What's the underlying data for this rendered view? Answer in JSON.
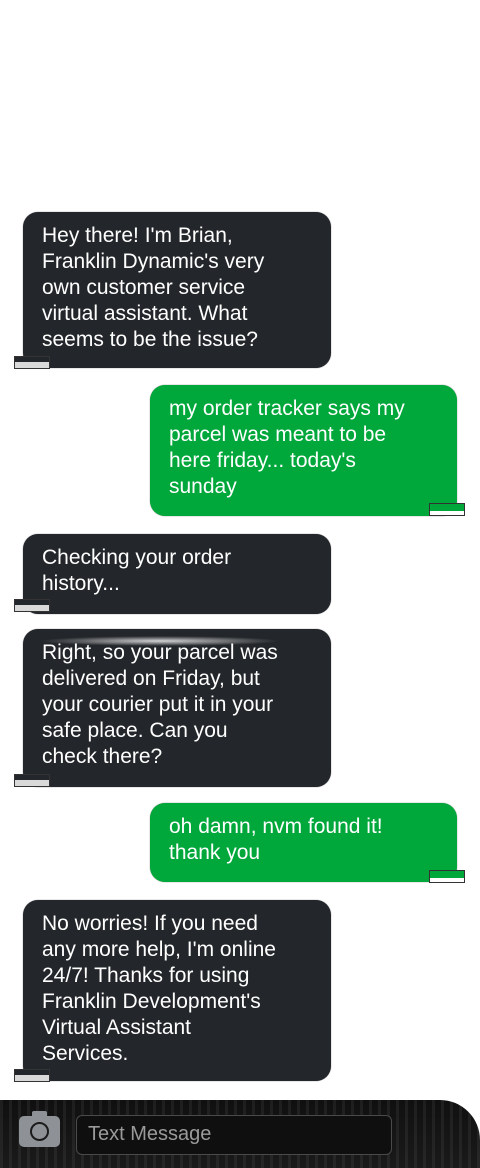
{
  "colors": {
    "incoming_bubble": "#23262a",
    "outgoing_bubble": "#00a73a",
    "text": "#ffffff"
  },
  "messages": [
    {
      "sender": "assistant",
      "text": "Hey there! I'm Brian,\nFranklin Dynamic's very\nown customer service\nvirtual assistant. What\nseems to be the issue?"
    },
    {
      "sender": "user",
      "text": "my order tracker says my\nparcel was meant to be\nhere friday... today's\nsunday"
    },
    {
      "sender": "assistant",
      "text": "Checking your order\nhistory..."
    },
    {
      "sender": "assistant",
      "text": "Right, so your parcel was\ndelivered on Friday, but\nyour courier put it in your\nsafe place. Can you\ncheck there?"
    },
    {
      "sender": "user",
      "text": "oh damn, nvm found it!\nthank you"
    },
    {
      "sender": "assistant",
      "text": "No worries! If you need\nany more help, I'm online\n24/7! Thanks for using\nFranklin Development's\nVirtual Assistant\nServices."
    }
  ],
  "input_bar": {
    "camera_icon": "camera-icon",
    "placeholder": "Text Message"
  }
}
